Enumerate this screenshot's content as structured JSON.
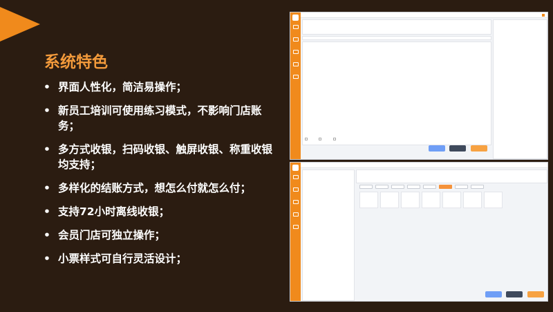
{
  "slide": {
    "title": "系统特色",
    "features": [
      "界面人性化，简洁易操作；",
      "新员工培训可使用练习模式，不影响门店账务；",
      "多方式收银，扫码收银、触屏收银、称重收银均支持；",
      "多样化的结账方式，想怎么付就怎么付；",
      "支持72小时离线收银；",
      "会员门店可独立操作；",
      "小票样式可自行灵活设计；"
    ],
    "bullet": "•"
  },
  "colors": {
    "background": "#2b1c11",
    "accent": "#f08a1c",
    "title": "#f39a3b"
  }
}
